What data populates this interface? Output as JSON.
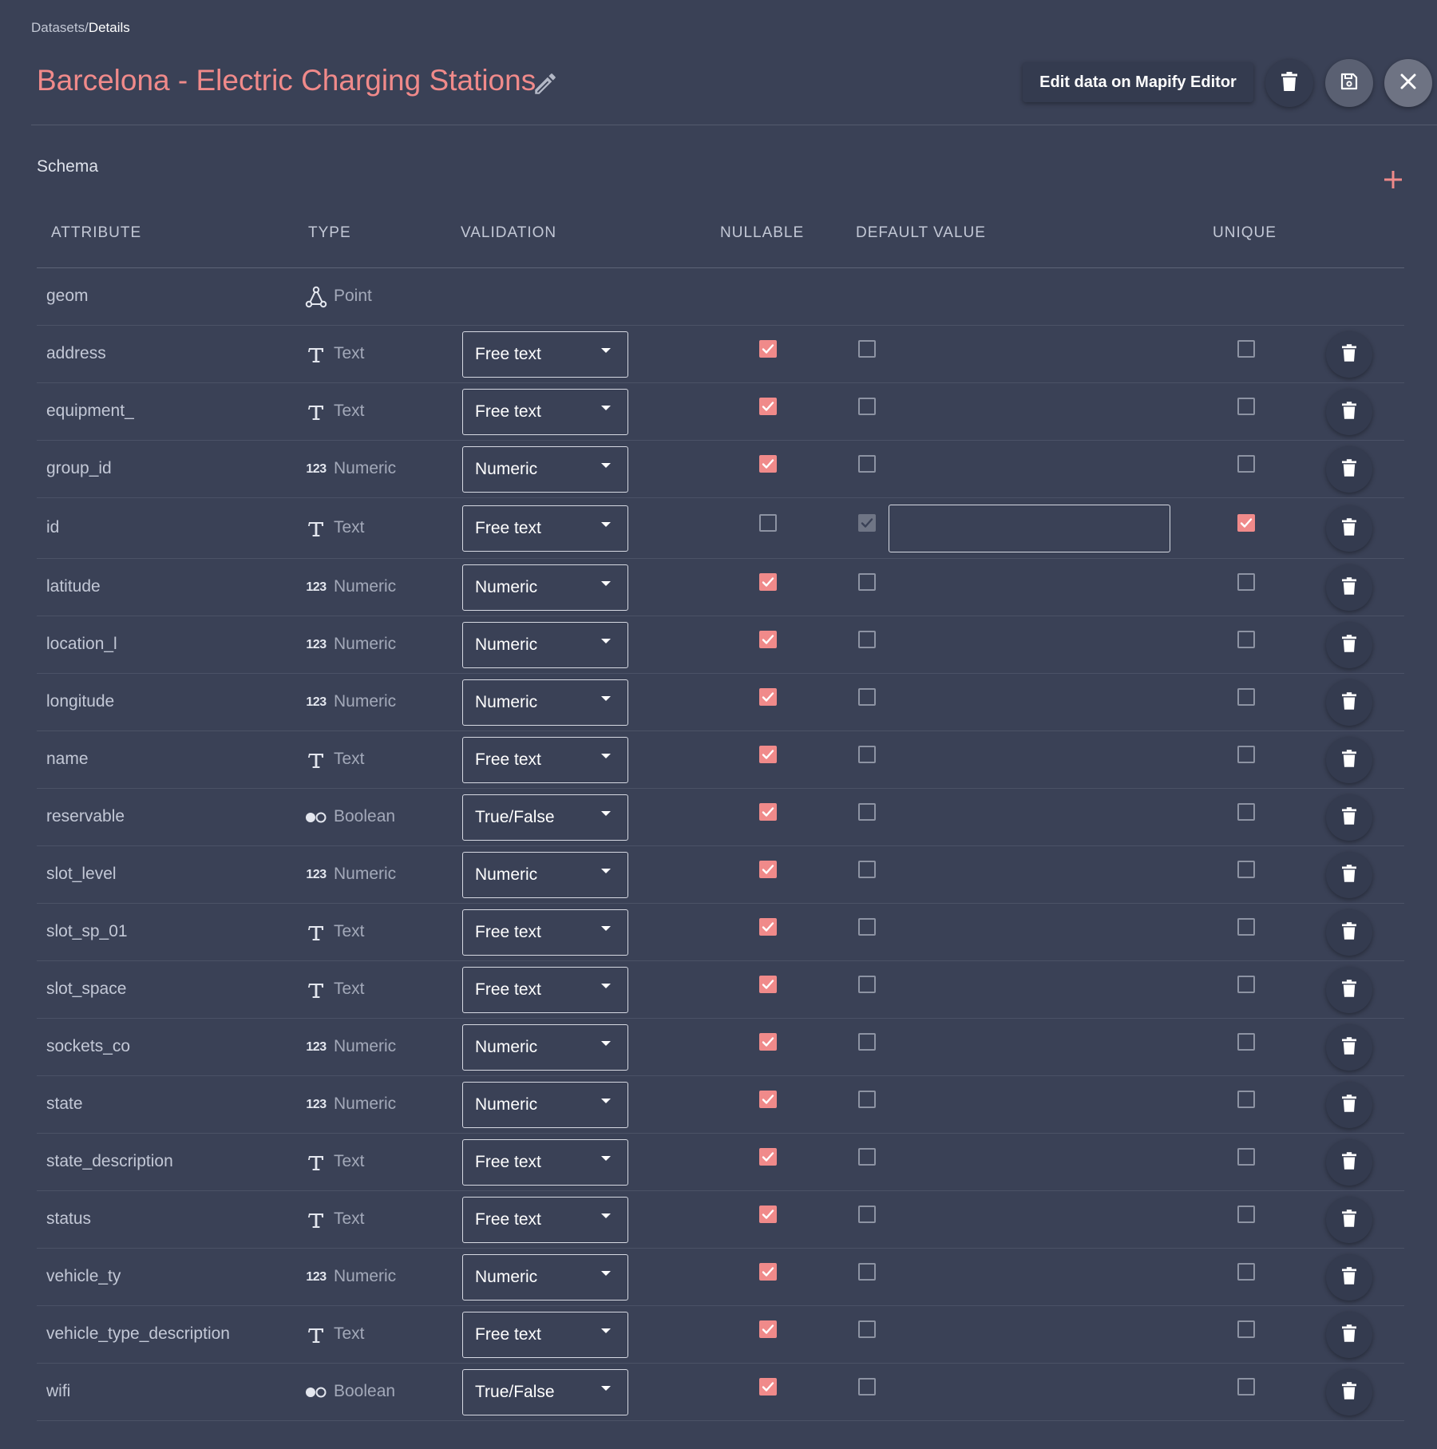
{
  "breadcrumb": {
    "parent": "Datasets",
    "separator": "/",
    "current": "Details"
  },
  "page": {
    "title": "Barcelona - Electric Charging Stations"
  },
  "toolbar": {
    "edit_label": "Edit data on Mapify Editor"
  },
  "schema": {
    "title": "Schema",
    "columns": {
      "attribute": "ATTRIBUTE",
      "type": "TYPE",
      "validation": "VALIDATION",
      "nullable": "NULLABLE",
      "default_value": "DEFAULT VALUE",
      "unique": "UNIQUE"
    },
    "rows": [
      {
        "attribute": "geom",
        "type": "Point",
        "icon": "point-icon"
      },
      {
        "attribute": "address",
        "type": "Text",
        "icon": "text-type-icon",
        "validation": "Free text",
        "nullable": true,
        "default": false,
        "unique": false
      },
      {
        "attribute": "equipment_",
        "type": "Text",
        "icon": "text-type-icon",
        "validation": "Free text",
        "nullable": true,
        "default": false,
        "unique": false
      },
      {
        "attribute": "group_id",
        "type": "Numeric",
        "icon": "numeric-type-icon",
        "validation": "Numeric",
        "nullable": true,
        "default": false,
        "unique": false
      },
      {
        "attribute": "id",
        "type": "Text",
        "icon": "text-type-icon",
        "validation": "Free text",
        "nullable": false,
        "default": true,
        "default_disabled": true,
        "default_value": "",
        "unique": true
      },
      {
        "attribute": "latitude",
        "type": "Numeric",
        "icon": "numeric-type-icon",
        "validation": "Numeric",
        "nullable": true,
        "default": false,
        "unique": false
      },
      {
        "attribute": "location_l",
        "type": "Numeric",
        "icon": "numeric-type-icon",
        "validation": "Numeric",
        "nullable": true,
        "default": false,
        "unique": false
      },
      {
        "attribute": "longitude",
        "type": "Numeric",
        "icon": "numeric-type-icon",
        "validation": "Numeric",
        "nullable": true,
        "default": false,
        "unique": false
      },
      {
        "attribute": "name",
        "type": "Text",
        "icon": "text-type-icon",
        "validation": "Free text",
        "nullable": true,
        "default": false,
        "unique": false
      },
      {
        "attribute": "reservable",
        "type": "Boolean",
        "icon": "boolean-type-icon",
        "validation": "True/False",
        "nullable": true,
        "default": false,
        "unique": false
      },
      {
        "attribute": "slot_level",
        "type": "Numeric",
        "icon": "numeric-type-icon",
        "validation": "Numeric",
        "nullable": true,
        "default": false,
        "unique": false
      },
      {
        "attribute": "slot_sp_01",
        "type": "Text",
        "icon": "text-type-icon",
        "validation": "Free text",
        "nullable": true,
        "default": false,
        "unique": false
      },
      {
        "attribute": "slot_space",
        "type": "Text",
        "icon": "text-type-icon",
        "validation": "Free text",
        "nullable": true,
        "default": false,
        "unique": false
      },
      {
        "attribute": "sockets_co",
        "type": "Numeric",
        "icon": "numeric-type-icon",
        "validation": "Numeric",
        "nullable": true,
        "default": false,
        "unique": false
      },
      {
        "attribute": "state",
        "type": "Numeric",
        "icon": "numeric-type-icon",
        "validation": "Numeric",
        "nullable": true,
        "default": false,
        "unique": false
      },
      {
        "attribute": "state_description",
        "type": "Text",
        "icon": "text-type-icon",
        "validation": "Free text",
        "nullable": true,
        "default": false,
        "unique": false
      },
      {
        "attribute": "status",
        "type": "Text",
        "icon": "text-type-icon",
        "validation": "Free text",
        "nullable": true,
        "default": false,
        "unique": false
      },
      {
        "attribute": "vehicle_ty",
        "type": "Numeric",
        "icon": "numeric-type-icon",
        "validation": "Numeric",
        "nullable": true,
        "default": false,
        "unique": false
      },
      {
        "attribute": "vehicle_type_description",
        "type": "Text",
        "icon": "text-type-icon",
        "validation": "Free text",
        "nullable": true,
        "default": false,
        "unique": false
      },
      {
        "attribute": "wifi",
        "type": "Boolean",
        "icon": "boolean-type-icon",
        "validation": "True/False",
        "nullable": true,
        "default": false,
        "unique": false
      }
    ]
  },
  "colors": {
    "background": "#3a4156",
    "accent": "#f08a8a",
    "button_dark": "#343b4f",
    "text": "#c3c8d6",
    "muted": "#a3a9b9"
  }
}
